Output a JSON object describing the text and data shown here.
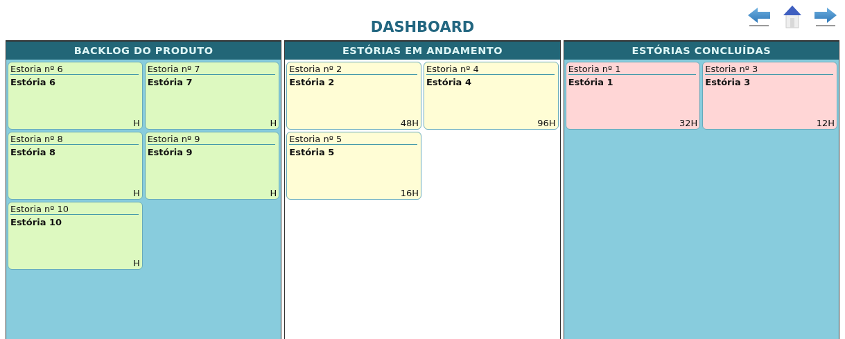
{
  "title": "DASHBOARD",
  "columns": [
    {
      "title": "BACKLOG DO PRODUTO",
      "kind": "backlog",
      "cards": [
        {
          "number": "Estoria nº 6",
          "name": "Estória 6",
          "hours": "H"
        },
        {
          "number": "Estoria nº 7",
          "name": "Estória 7",
          "hours": "H"
        },
        {
          "number": "Estoria nº 8",
          "name": "Estória 8",
          "hours": "H"
        },
        {
          "number": "Estoria nº 9",
          "name": "Estória 9",
          "hours": "H"
        },
        {
          "number": "Estoria nº 10",
          "name": "Estória 10",
          "hours": "H"
        }
      ]
    },
    {
      "title": "ESTÓRIAS EM ANDAMENTO",
      "kind": "progress",
      "cards": [
        {
          "number": "Estoria nº 2",
          "name": "Estória 2",
          "hours": "48H"
        },
        {
          "number": "Estoria nº 4",
          "name": "Estória 4",
          "hours": "96H"
        },
        {
          "number": "Estoria nº 5",
          "name": "Estória 5",
          "hours": "16H"
        }
      ]
    },
    {
      "title": "ESTÓRIAS CONCLUÍDAS",
      "kind": "done",
      "cards": [
        {
          "number": "Estoria nº 1",
          "name": "Estória 1",
          "hours": "32H"
        },
        {
          "number": "Estoria nº 3",
          "name": "Estória 3",
          "hours": "12H"
        }
      ]
    }
  ]
}
